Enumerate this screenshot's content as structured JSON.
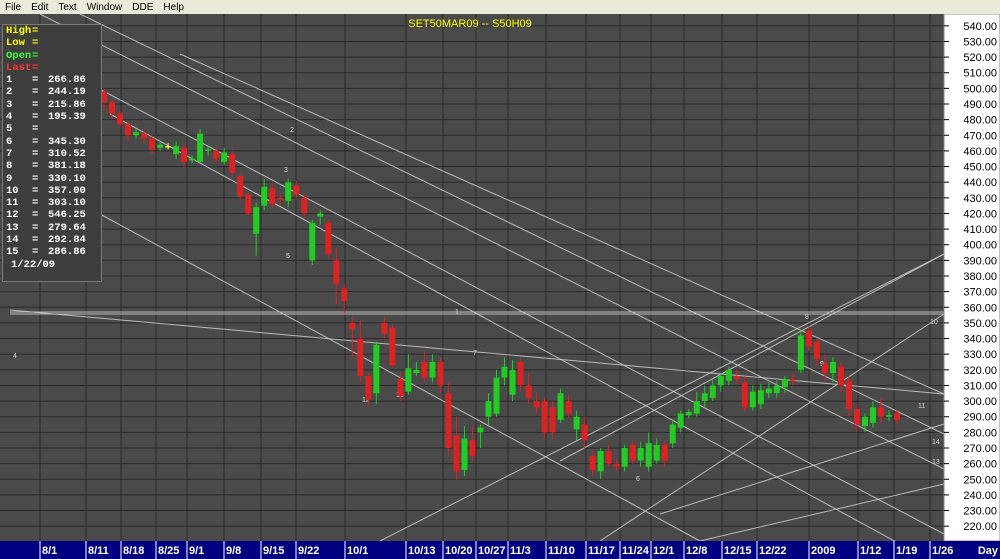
{
  "menu": [
    "File",
    "Edit",
    "Text",
    "Window",
    "DDE",
    "Help"
  ],
  "chart_data": {
    "type": "candlestick",
    "title": "SET50MAR09  --  S50H09",
    "xlabel": "Day",
    "ylim": [
      215,
      545
    ],
    "y_ticks": [
      220,
      230,
      240,
      250,
      260,
      270,
      280,
      290,
      300,
      310,
      320,
      330,
      340,
      350,
      360,
      370,
      380,
      390,
      400,
      410,
      420,
      430,
      440,
      450,
      460,
      470,
      480,
      490,
      500,
      510,
      520,
      530,
      540
    ],
    "y_tick_labels": [
      "220.00",
      "230.00",
      "240.00",
      "250.00",
      "260.00",
      "270.00",
      "280.00",
      "290.00",
      "300.00",
      "310.00",
      "320.00",
      "330.00",
      "340.00",
      "350.00",
      "360.00",
      "370.00",
      "380.00",
      "390.00",
      "400.00",
      "410.00",
      "420.00",
      "430.00",
      "440.00",
      "450.00",
      "460.00",
      "470.00",
      "480.00",
      "490.00",
      "500.00",
      "510.00",
      "520.00",
      "530.00",
      "540.00"
    ],
    "x_ticks": [
      "8/1",
      "8/11",
      "8/18",
      "8/25",
      "9/1",
      "9/8",
      "9/15",
      "9/22",
      "10/1",
      "10/13",
      "10/20",
      "10/27",
      "11/3",
      "11/10",
      "11/17",
      "11/24",
      "12/1",
      "12/8",
      "12/15",
      "12/22",
      "2009",
      "1/12",
      "1/19",
      "1/26"
    ],
    "candles": [
      {
        "o": 498,
        "c": 491,
        "h": 500,
        "l": 486
      },
      {
        "o": 491,
        "c": 484,
        "h": 493,
        "l": 480
      },
      {
        "o": 484,
        "c": 477,
        "h": 486,
        "l": 474
      },
      {
        "o": 477,
        "c": 470,
        "h": 478,
        "l": 466
      },
      {
        "o": 470,
        "c": 472,
        "h": 474,
        "l": 468
      },
      {
        "o": 471,
        "c": 468,
        "h": 474,
        "l": 465
      },
      {
        "o": 468,
        "c": 461,
        "h": 470,
        "l": 458
      },
      {
        "o": 462,
        "c": 464,
        "h": 466,
        "l": 460
      },
      {
        "o": 463,
        "c": 463,
        "h": 465,
        "l": 461
      },
      {
        "o": 458,
        "c": 463,
        "h": 466,
        "l": 455
      },
      {
        "o": 462,
        "c": 453,
        "h": 464,
        "l": 450
      },
      {
        "o": 454,
        "c": 455,
        "h": 457,
        "l": 452
      },
      {
        "o": 453,
        "c": 471,
        "h": 474,
        "l": 452
      },
      {
        "o": 460,
        "c": 461,
        "h": 463,
        "l": 457
      },
      {
        "o": 460,
        "c": 455,
        "h": 462,
        "l": 452
      },
      {
        "o": 453,
        "c": 459,
        "h": 462,
        "l": 451
      },
      {
        "o": 458,
        "c": 446,
        "h": 460,
        "l": 443
      },
      {
        "o": 444,
        "c": 431,
        "h": 446,
        "l": 428
      },
      {
        "o": 432,
        "c": 420,
        "h": 434,
        "l": 418
      },
      {
        "o": 407,
        "c": 424,
        "h": 427,
        "l": 393
      },
      {
        "o": 425,
        "c": 437,
        "h": 442,
        "l": 422
      },
      {
        "o": 436,
        "c": 426,
        "h": 440,
        "l": 423
      },
      {
        "o": 430,
        "c": 429,
        "h": 433,
        "l": 425
      },
      {
        "o": 428,
        "c": 440,
        "h": 442,
        "l": 424
      },
      {
        "o": 438,
        "c": 432,
        "h": 441,
        "l": 429
      },
      {
        "o": 430,
        "c": 420,
        "h": 433,
        "l": 417
      },
      {
        "o": 390,
        "c": 414,
        "h": 416,
        "l": 387
      },
      {
        "o": 418,
        "c": 420,
        "h": 422,
        "l": 413
      },
      {
        "o": 414,
        "c": 394,
        "h": 416,
        "l": 391
      },
      {
        "o": 390,
        "c": 375,
        "h": 398,
        "l": 362
      },
      {
        "o": 372,
        "c": 364,
        "h": 375,
        "l": 356
      },
      {
        "o": 350,
        "c": 346,
        "h": 353,
        "l": 328
      },
      {
        "o": 340,
        "c": 316,
        "h": 352,
        "l": 312
      },
      {
        "o": 316,
        "c": 301,
        "h": 318,
        "l": 297
      },
      {
        "o": 305,
        "c": 336,
        "h": 338,
        "l": 298
      },
      {
        "o": 350,
        "c": 343,
        "h": 354,
        "l": 340
      },
      {
        "o": 347,
        "c": 323,
        "h": 349,
        "l": 321
      },
      {
        "o": 314,
        "c": 303,
        "h": 319,
        "l": 300
      },
      {
        "o": 306,
        "c": 321,
        "h": 330,
        "l": 304
      },
      {
        "o": 318,
        "c": 320,
        "h": 325,
        "l": 316
      },
      {
        "o": 325,
        "c": 315,
        "h": 332,
        "l": 312
      },
      {
        "o": 315,
        "c": 325,
        "h": 330,
        "l": 312
      },
      {
        "o": 325,
        "c": 310,
        "h": 328,
        "l": 305
      },
      {
        "o": 305,
        "c": 270,
        "h": 312,
        "l": 265
      },
      {
        "o": 278,
        "c": 255,
        "h": 290,
        "l": 250
      },
      {
        "o": 256,
        "c": 276,
        "h": 284,
        "l": 252
      },
      {
        "o": 275,
        "c": 265,
        "h": 284,
        "l": 262
      },
      {
        "o": 280,
        "c": 283,
        "h": 285,
        "l": 270
      },
      {
        "o": 290,
        "c": 300,
        "h": 305,
        "l": 285
      },
      {
        "o": 292,
        "c": 315,
        "h": 320,
        "l": 290
      },
      {
        "o": 315,
        "c": 322,
        "h": 328,
        "l": 310
      },
      {
        "o": 304,
        "c": 320,
        "h": 326,
        "l": 300
      },
      {
        "o": 325,
        "c": 310,
        "h": 328,
        "l": 306
      },
      {
        "o": 310,
        "c": 302,
        "h": 318,
        "l": 298
      },
      {
        "o": 300,
        "c": 296,
        "h": 306,
        "l": 292
      },
      {
        "o": 300,
        "c": 280,
        "h": 302,
        "l": 276
      },
      {
        "o": 296,
        "c": 280,
        "h": 300,
        "l": 276
      },
      {
        "o": 288,
        "c": 305,
        "h": 308,
        "l": 286
      },
      {
        "o": 300,
        "c": 292,
        "h": 304,
        "l": 289
      },
      {
        "o": 282,
        "c": 290,
        "h": 294,
        "l": 275
      },
      {
        "o": 285,
        "c": 275,
        "h": 290,
        "l": 270
      },
      {
        "o": 265,
        "c": 256,
        "h": 268,
        "l": 252
      },
      {
        "o": 255,
        "c": 268,
        "h": 270,
        "l": 250
      },
      {
        "o": 268,
        "c": 260,
        "h": 272,
        "l": 258
      },
      {
        "o": 260,
        "c": 258,
        "h": 264,
        "l": 255
      },
      {
        "o": 258,
        "c": 270,
        "h": 272,
        "l": 255
      },
      {
        "o": 272,
        "c": 262,
        "h": 275,
        "l": 260
      },
      {
        "o": 262,
        "c": 270,
        "h": 274,
        "l": 258
      },
      {
        "o": 258,
        "c": 273,
        "h": 280,
        "l": 255
      },
      {
        "o": 262,
        "c": 272,
        "h": 276,
        "l": 260
      },
      {
        "o": 272,
        "c": 262,
        "h": 275,
        "l": 258
      },
      {
        "o": 273,
        "c": 285,
        "h": 288,
        "l": 270
      },
      {
        "o": 283,
        "c": 292,
        "h": 294,
        "l": 280
      },
      {
        "o": 291,
        "c": 293,
        "h": 295,
        "l": 289
      },
      {
        "o": 292,
        "c": 300,
        "h": 306,
        "l": 290
      },
      {
        "o": 300,
        "c": 305,
        "h": 310,
        "l": 296
      },
      {
        "o": 302,
        "c": 310,
        "h": 314,
        "l": 300
      },
      {
        "o": 310,
        "c": 316,
        "h": 318,
        "l": 306
      },
      {
        "o": 313,
        "c": 320,
        "h": 322,
        "l": 310
      },
      {
        "o": 316,
        "c": 314,
        "h": 320,
        "l": 311
      },
      {
        "o": 312,
        "c": 296,
        "h": 316,
        "l": 293
      },
      {
        "o": 296,
        "c": 306,
        "h": 310,
        "l": 294
      },
      {
        "o": 298,
        "c": 307,
        "h": 311,
        "l": 295
      },
      {
        "o": 305,
        "c": 308,
        "h": 312,
        "l": 302
      },
      {
        "o": 305,
        "c": 310,
        "h": 313,
        "l": 302
      },
      {
        "o": 309,
        "c": 314,
        "h": 316,
        "l": 305
      },
      {
        "o": 314,
        "c": 313,
        "h": 318,
        "l": 310
      },
      {
        "o": 320,
        "c": 342,
        "h": 345,
        "l": 318
      },
      {
        "o": 345,
        "c": 335,
        "h": 348,
        "l": 332
      },
      {
        "o": 338,
        "c": 327,
        "h": 340,
        "l": 323
      },
      {
        "o": 324,
        "c": 318,
        "h": 330,
        "l": 313
      },
      {
        "o": 318,
        "c": 325,
        "h": 328,
        "l": 312
      },
      {
        "o": 322,
        "c": 310,
        "h": 325,
        "l": 306
      },
      {
        "o": 313,
        "c": 295,
        "h": 316,
        "l": 290
      },
      {
        "o": 295,
        "c": 285,
        "h": 298,
        "l": 280
      },
      {
        "o": 284,
        "c": 290,
        "h": 292,
        "l": 280
      },
      {
        "o": 286,
        "c": 296,
        "h": 300,
        "l": 283
      },
      {
        "o": 296,
        "c": 290,
        "h": 302,
        "l": 286
      },
      {
        "o": 290,
        "c": 291,
        "h": 294,
        "l": 287
      },
      {
        "o": 292,
        "c": 288,
        "h": 294,
        "l": 285
      }
    ],
    "gann_line_labels": [
      "1",
      "2",
      "3",
      "4",
      "5",
      "6",
      "7",
      "8",
      "9",
      "10",
      "11",
      "12",
      "13",
      "14",
      "15"
    ],
    "colors": {
      "up": "#22cc22",
      "down": "#dd2222",
      "doji": "#ffff33",
      "grid": "#2a2a2a",
      "lines": "#cfcfcf",
      "background": "#4a4a4a",
      "axis_text": "#000000"
    }
  },
  "databox": {
    "rows": [
      {
        "key": "High",
        "eq": "=",
        "val": "",
        "color": "#ffff00"
      },
      {
        "key": "Low",
        "eq": "=",
        "val": "",
        "color": "#ffff00"
      },
      {
        "key": "Open",
        "eq": "=",
        "val": "",
        "color": "#33ff33"
      },
      {
        "key": "Last",
        "eq": "=",
        "val": "",
        "color": "#ff3333"
      },
      {
        "key": "1",
        "eq": "=",
        "val": "266.86",
        "color": "#ffffff"
      },
      {
        "key": "2",
        "eq": "=",
        "val": "244.19",
        "color": "#ffffff"
      },
      {
        "key": "3",
        "eq": "=",
        "val": "215.86",
        "color": "#ffffff"
      },
      {
        "key": "4",
        "eq": "=",
        "val": "195.39",
        "color": "#ffffff"
      },
      {
        "key": "5",
        "eq": "=",
        "val": "",
        "color": "#ffffff"
      },
      {
        "key": "6",
        "eq": "=",
        "val": "345.30",
        "color": "#ffffff"
      },
      {
        "key": "7",
        "eq": "=",
        "val": "310.52",
        "color": "#ffffff"
      },
      {
        "key": "8",
        "eq": "=",
        "val": "381.18",
        "color": "#ffffff"
      },
      {
        "key": "9",
        "eq": "=",
        "val": "330.10",
        "color": "#ffffff"
      },
      {
        "key": "10",
        "eq": "=",
        "val": "357.00",
        "color": "#ffffff"
      },
      {
        "key": "11",
        "eq": "=",
        "val": "303.10",
        "color": "#ffffff"
      },
      {
        "key": "12",
        "eq": "=",
        "val": "546.25",
        "color": "#ffffff"
      },
      {
        "key": "13",
        "eq": "=",
        "val": "279.64",
        "color": "#ffffff"
      },
      {
        "key": "14",
        "eq": "=",
        "val": "292.84",
        "color": "#ffffff"
      },
      {
        "key": "15",
        "eq": "=",
        "val": "286.86",
        "color": "#ffffff"
      }
    ],
    "date": "1/22/09"
  }
}
